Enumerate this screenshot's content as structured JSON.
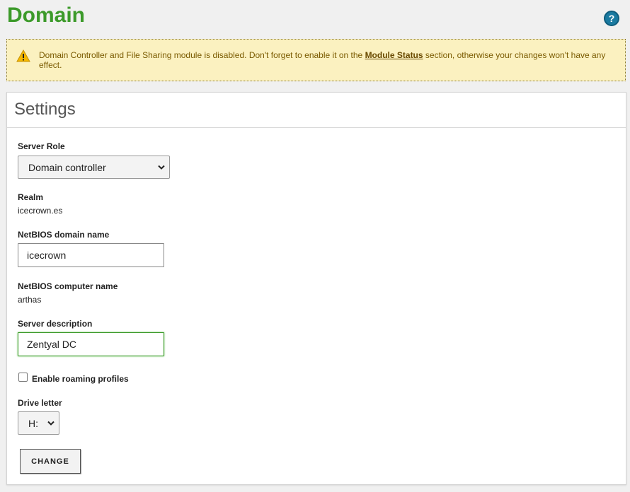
{
  "page": {
    "title": "Domain"
  },
  "warning": {
    "text_before": "Domain Controller and File Sharing module is disabled. Don't forget to enable it on the ",
    "link": "Module Status",
    "text_after": " section, otherwise your changes won't have any effect."
  },
  "settings": {
    "title": "Settings",
    "server_role": {
      "label": "Server Role",
      "value": "Domain controller"
    },
    "realm": {
      "label": "Realm",
      "value": "icecrown.es"
    },
    "netbios_domain": {
      "label": "NetBIOS domain name",
      "value": "icecrown"
    },
    "netbios_computer": {
      "label": "NetBIOS computer name",
      "value": "arthas"
    },
    "server_description": {
      "label": "Server description",
      "value": "Zentyal DC"
    },
    "roaming": {
      "label": "Enable roaming profiles",
      "checked": false
    },
    "drive_letter": {
      "label": "Drive letter",
      "value": "H:"
    },
    "change_button": "CHANGE"
  },
  "icons": {
    "help": "help-icon",
    "warning": "warning-icon",
    "chevron": "chevron-down-icon"
  },
  "colors": {
    "title_green": "#3c9a2a",
    "warning_bg": "#fbf1c0",
    "help_blue": "#1a7aa0",
    "focus_green": "#3c9a2a"
  }
}
